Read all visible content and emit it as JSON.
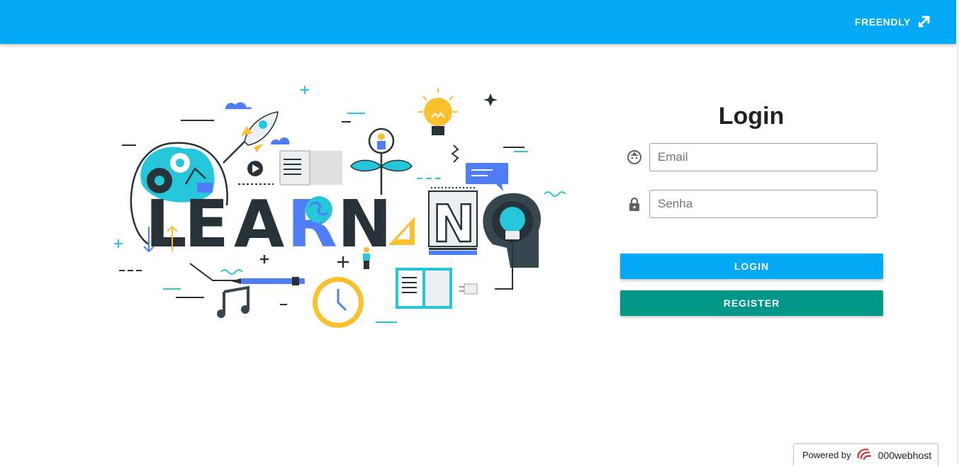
{
  "header": {
    "brand_label": "FREENDLY",
    "brand_icon": "arrow-up-right-icon",
    "background_color": "#03a9f4"
  },
  "illustration": {
    "letters": [
      "L",
      "E",
      "A",
      "R",
      "N",
      "I",
      "N",
      "G"
    ]
  },
  "login": {
    "title": "Login",
    "email_placeholder": "Email",
    "email_icon": "face-icon",
    "password_placeholder": "Senha",
    "password_icon": "lock-icon",
    "login_button": "LOGIN",
    "register_button": "REGISTER",
    "login_color": "#03a9f4",
    "register_color": "#009688"
  },
  "footer": {
    "powered_label": "Powered by",
    "host_name": "000webhost"
  }
}
